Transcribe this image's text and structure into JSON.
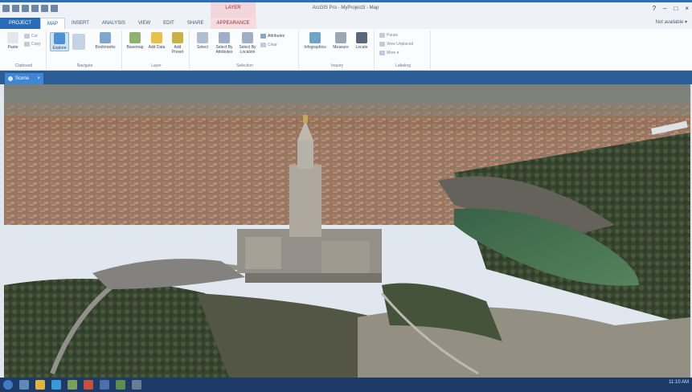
{
  "window": {
    "title": "ArcGIS Pro - MyProject3 - Map",
    "contextual_group": "LAYER",
    "controls": [
      "?",
      "–",
      "□",
      "×"
    ]
  },
  "ribbon_tabs": [
    {
      "label": "PROJECT"
    },
    {
      "label": "MAP"
    },
    {
      "label": "INSERT"
    },
    {
      "label": "ANALYSIS"
    },
    {
      "label": "VIEW"
    },
    {
      "label": "EDIT"
    },
    {
      "label": "SHARE"
    },
    {
      "label": "APPEARANCE"
    }
  ],
  "account": {
    "label": "Not available ▾"
  },
  "ribbon": {
    "clipboard": {
      "label": "Clipboard",
      "paste": "Paste",
      "cut": "Cut",
      "copy": "Copy"
    },
    "navigate": {
      "label": "Navigate",
      "explore": "Explore",
      "bookmarks": "Bookmarks"
    },
    "layer": {
      "label": "Layer",
      "basemap": "Basemap",
      "add_data": "Add Data",
      "add_preset": "Add Preset"
    },
    "selection": {
      "label": "Selection",
      "select": "Select",
      "select_by_attributes": "Select By Attributes",
      "select_by_location": "Select By Location",
      "attributes": "Attributes",
      "clear": "Clear"
    },
    "inquiry": {
      "label": "Inquiry",
      "infographics": "Infographics",
      "measure": "Measure",
      "locate": "Locate"
    },
    "labeling": {
      "label": "Labeling",
      "pause": "Pause",
      "view_unplaced": "View Unplaced",
      "more": "More ▾"
    }
  },
  "view_tab": {
    "label": "Scene"
  },
  "colors": {
    "accent": "#2a6cb6",
    "ribbon_bg": "#fbfcfd",
    "taskbar": "#1e3b68",
    "contextual": "#9b2d3c"
  },
  "taskbar": {
    "clock": "11:10 AM"
  }
}
